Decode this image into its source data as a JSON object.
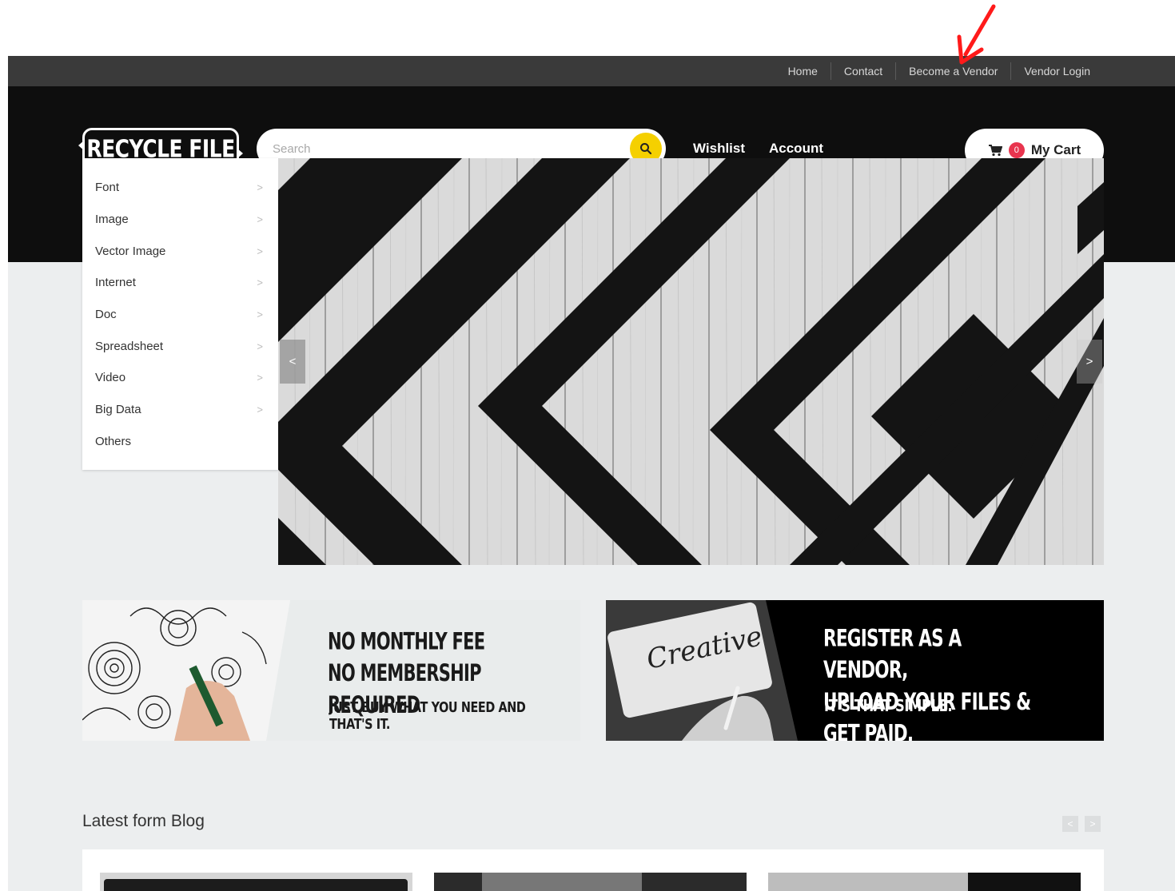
{
  "topnav": {
    "links": [
      "Home",
      "Contact",
      "Become a Vendor",
      "Vendor Login"
    ]
  },
  "header": {
    "logo_text": "RECYCLE FILE",
    "search_placeholder": "Search",
    "wishlist_label": "Wishlist",
    "account_label": "Account",
    "cart": {
      "count": "0",
      "label": "My Cart"
    }
  },
  "categories": [
    "Font",
    "Image",
    "Vector Image",
    "Internet",
    "Doc",
    "Spreadsheet",
    "Video",
    "Big Data",
    "Others"
  ],
  "banners": {
    "left": {
      "headline_1": "NO MONTHLY FEE",
      "headline_2": "NO MEMBERSHIP REQUIRED",
      "sub": "JUST BUY WHAT YOU NEED AND THAT'S IT."
    },
    "right": {
      "image_text": "Creative",
      "headline_1": "REGISTER AS A VENDOR,",
      "headline_2": "UPLOAD YOUR FILES & GET PAID.",
      "sub": "IT'S THAT SIMPLE."
    }
  },
  "blog": {
    "title": "Latest form Blog",
    "prev_icon": "chevron-left-icon",
    "next_icon": "chevron-right-icon"
  },
  "colors": {
    "accent": "#f5d000",
    "badge": "#e8344e",
    "header_bg": "#0e0e0e",
    "topbar_bg": "#3a3a3a",
    "page_bg": "#eceeef",
    "annotation_arrow": "#ff1a1a"
  }
}
